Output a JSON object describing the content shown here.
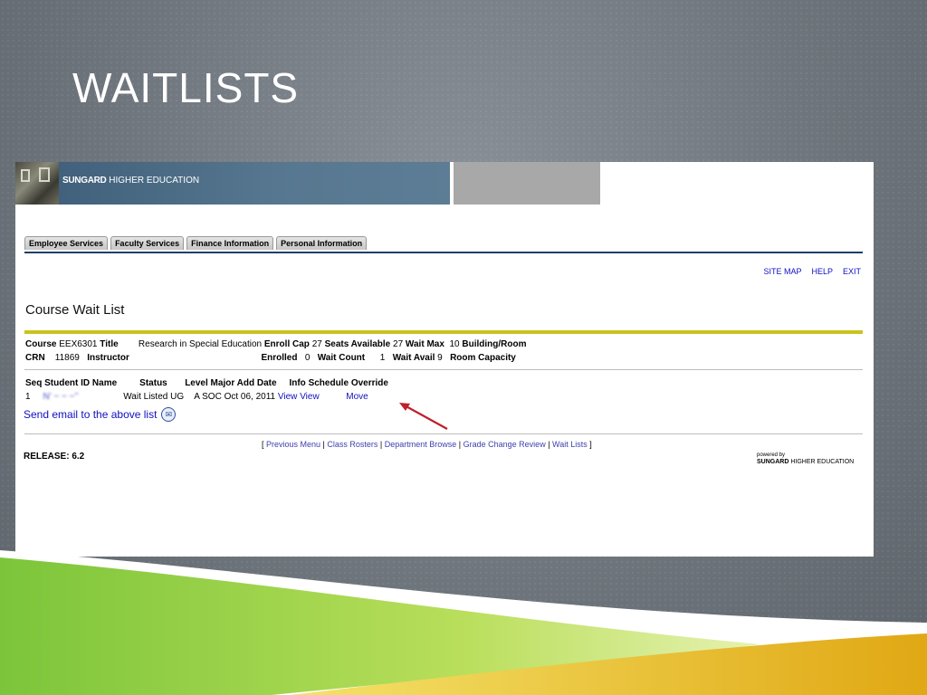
{
  "slide": {
    "title": "WAITLISTS"
  },
  "banner": {
    "brand": "SUNGARD",
    "brand_suffix": "HIGHER EDUCATION"
  },
  "tabs": [
    {
      "label": "Employee Services"
    },
    {
      "label": "Faculty Services"
    },
    {
      "label": "Finance Information"
    },
    {
      "label": "Personal Information"
    }
  ],
  "toplinks": {
    "site_map": "SITE MAP",
    "help": "HELP",
    "exit": "EXIT"
  },
  "page": {
    "heading": "Course Wait List"
  },
  "course": {
    "course_label": "Course",
    "course_value": "EEX6301",
    "title_label": "Title",
    "title_value": "Research in Special Education",
    "enroll_cap_label": "Enroll Cap",
    "enroll_cap_value": "27",
    "seats_available_label": "Seats Available",
    "seats_available_value": "27",
    "wait_max_label": "Wait Max",
    "wait_max_value": "10",
    "building_room_label": "Building/Room",
    "crn_label": "CRN",
    "crn_value": "11869",
    "instructor_label": "Instructor",
    "enrolled_label": "Enrolled",
    "enrolled_value": "0",
    "wait_count_label": "Wait Count",
    "wait_count_value": "1",
    "wait_avail_label": "Wait Avail",
    "wait_avail_value": "9",
    "room_capacity_label": "Room Capacity"
  },
  "waitlist": {
    "headers": [
      "Seq",
      "Student ID",
      "Name",
      "Status",
      "Level",
      "Major",
      "Add Date",
      "Info",
      "Schedule",
      "Override"
    ],
    "row": {
      "seq": "1",
      "student_id": "N’ ~ ~ ~’’",
      "status": "Wait Listed",
      "level": "UG",
      "major": "A SOC",
      "add_date": "Oct 06, 2011",
      "info": "View",
      "schedule": "View",
      "override": "Move"
    },
    "email_link": "Send email to the above list"
  },
  "footer": {
    "links": [
      "Previous Menu",
      "Class Rosters",
      "Department Browse",
      "Grade Change Review",
      "Wait Lists"
    ],
    "release": "RELEASE: 6.2",
    "powered_by": "powered by",
    "powered_brand": "SUNGARD",
    "powered_suffix": "HIGHER EDUCATION"
  },
  "colors": {
    "link": "#1010c0",
    "tab_rule": "#1f3d6a",
    "accent_rule": "#c8c41c",
    "arrow": "#c0202a"
  }
}
